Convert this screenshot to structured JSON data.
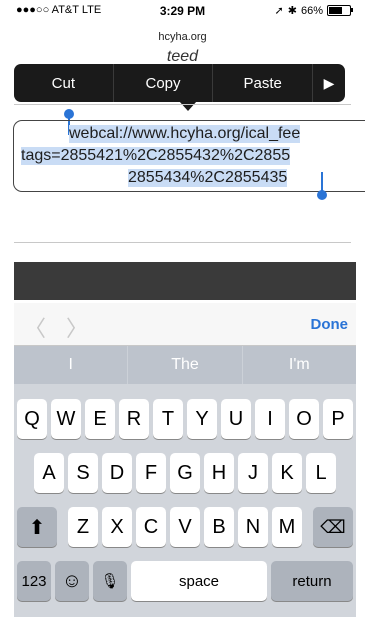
{
  "status": {
    "carrier": "●●●○○ AT&T LTE",
    "time": "3:29 PM",
    "battery": "66%",
    "battery_level": 0.66
  },
  "browser": {
    "url": "hcyha.org",
    "page_text": "teed"
  },
  "edit_menu": {
    "cut": "Cut",
    "copy": "Copy",
    "paste": "Paste",
    "more": "▶"
  },
  "text_field": {
    "line1": "webcal://www.hcyha.org/ical_fee",
    "line2": "tags=2855421%2C2855432%2C2855",
    "line3": "2855434%2C2855435"
  },
  "accessory": {
    "prev": "〈",
    "next": "〉",
    "done": "Done"
  },
  "predictions": [
    "I",
    "The",
    "I'm"
  ],
  "keyboard": {
    "row1": [
      "Q",
      "W",
      "E",
      "R",
      "T",
      "Y",
      "U",
      "I",
      "O",
      "P"
    ],
    "row2": [
      "A",
      "S",
      "D",
      "F",
      "G",
      "H",
      "J",
      "K",
      "L"
    ],
    "row3": [
      "Z",
      "X",
      "C",
      "V",
      "B",
      "N",
      "M"
    ],
    "shift": "⬆",
    "backspace": "⌫",
    "numbers": "123",
    "emoji": "☺",
    "mic": "🎙",
    "space": "space",
    "return": "return"
  }
}
